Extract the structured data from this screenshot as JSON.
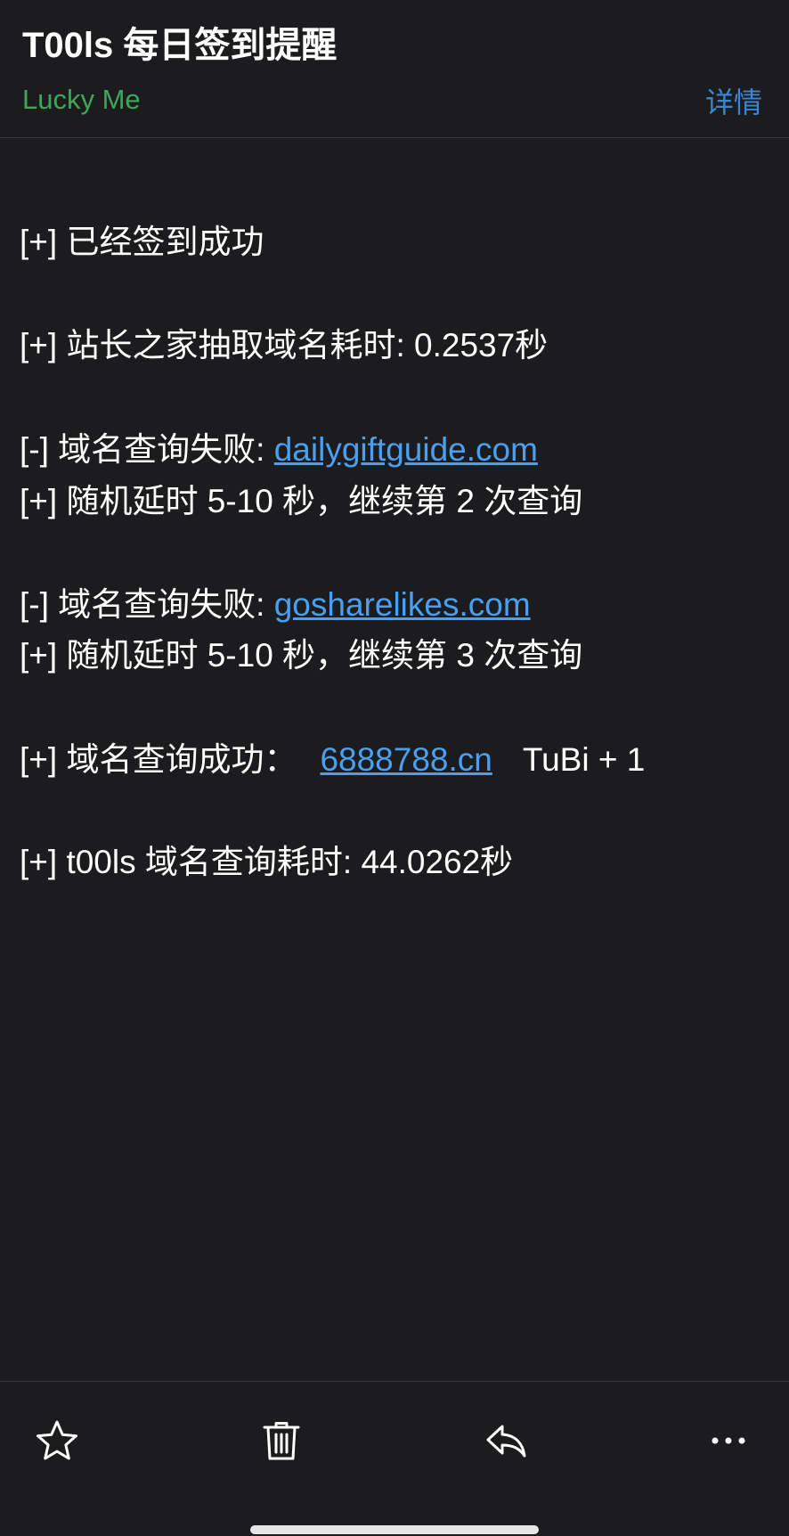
{
  "header": {
    "title": "T00ls 每日签到提醒",
    "sender": "Lucky Me",
    "details_label": "详情"
  },
  "body": {
    "line1": "[+] 已经签到成功",
    "line2": "[+] 站长之家抽取域名耗时: 0.2537秒",
    "line3_prefix": "[-] 域名查询失败: ",
    "line3_link": "dailygiftguide.com",
    "line4": "[+] 随机延时 5-10 秒，继续第 2 次查询",
    "line5_prefix": "[-] 域名查询失败: ",
    "line5_link": "gosharelikes.com",
    "line6": "[+] 随机延时 5-10 秒，继续第 3 次查询",
    "line7_prefix": "[+] 域名查询成功：",
    "line7_link": "6888788.cn",
    "line7_suffix": "TuBi + 1",
    "line8": "[+] t00ls 域名查询耗时: 44.0262秒"
  },
  "toolbar": {
    "icons": [
      "star-icon",
      "trash-icon",
      "reply-icon",
      "more-icon"
    ]
  },
  "colors": {
    "background": "#1c1c1e",
    "sender_green": "#3fa55b",
    "details_blue": "#3a86d6",
    "link_blue": "#4a9ff0",
    "text": "#ffffff"
  }
}
